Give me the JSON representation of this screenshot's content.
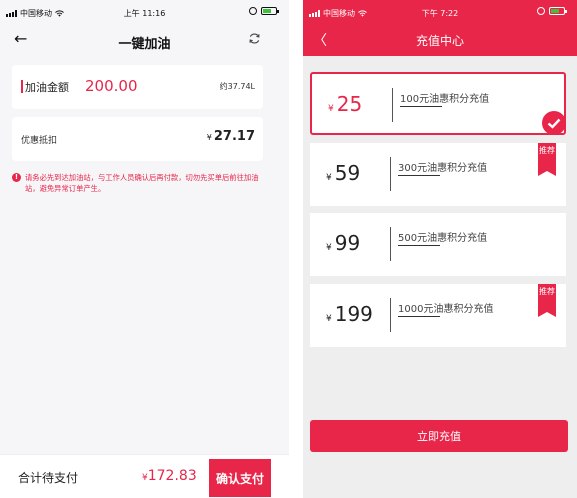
{
  "left": {
    "status": {
      "carrier": "中国移动",
      "time": "上午 11:16"
    },
    "nav": {
      "title": "一键加油"
    },
    "amount": {
      "label": "加油金额",
      "value": "200.00",
      "approx": "约37.74L"
    },
    "discount": {
      "label": "优惠抵扣",
      "value": "27.17",
      "yen": "¥"
    },
    "notice": "请务必先到达加油站，与工作人员确认后再付款，切勿先买单后前往加油站，避免异常订单产生。",
    "footer": {
      "total_label": "合计待支付",
      "yen": "¥",
      "total_value": "172.83",
      "pay_label": "确认支付"
    }
  },
  "right": {
    "status": {
      "carrier": "中国移动",
      "time": "下午 7:22"
    },
    "header": {
      "title": "充值中心"
    },
    "options": [
      {
        "yen": "¥",
        "price": "25",
        "desc": "100元油惠积分充值",
        "tag": "",
        "selected": true
      },
      {
        "yen": "¥",
        "price": "59",
        "desc": "300元油惠积分充值",
        "tag": "推荐",
        "selected": false
      },
      {
        "yen": "¥",
        "price": "99",
        "desc": "500元油惠积分充值",
        "tag": "",
        "selected": false
      },
      {
        "yen": "¥",
        "price": "199",
        "desc": "1000元油惠积分充值",
        "tag": "推荐",
        "selected": false
      }
    ],
    "recharge_label": "立即充值"
  },
  "colors": {
    "accent": "#e8264a",
    "background": "#f6f6f8"
  },
  "icons": [
    "back-arrow-icon",
    "refresh-icon",
    "warning-icon",
    "check-icon",
    "signal-icon",
    "wifi-icon",
    "battery-icon"
  ]
}
